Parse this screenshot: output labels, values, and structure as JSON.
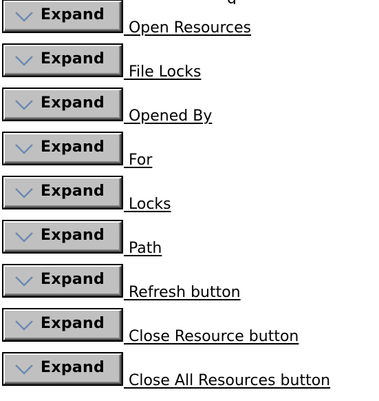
{
  "top_fragment": "g",
  "expand_label": "Expand",
  "items": [
    {
      "label": " Open Resources"
    },
    {
      "label": " File Locks"
    },
    {
      "label": " Opened By"
    },
    {
      "label": " For"
    },
    {
      "label": " Locks"
    },
    {
      "label": " Path"
    },
    {
      "label": " Refresh button"
    },
    {
      "label": " Close Resource button"
    },
    {
      "label": " Close All Resources button"
    }
  ],
  "colors": {
    "button_face": "#c0c0c0",
    "chevron": "#6c8ab4"
  },
  "icons": [
    "chevron-down-icon"
  ]
}
